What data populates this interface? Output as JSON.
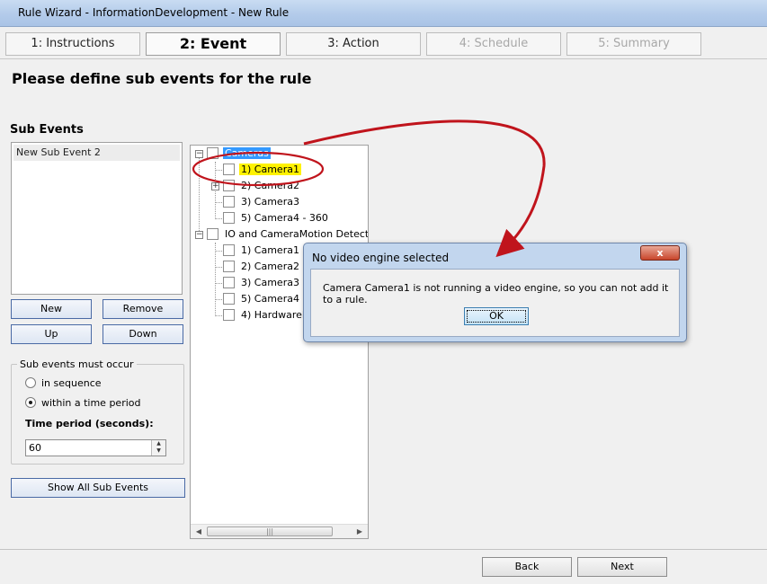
{
  "window": {
    "title": "Rule Wizard - InformationDevelopment - New Rule"
  },
  "tabs": [
    {
      "label": "1: Instructions",
      "state": "normal"
    },
    {
      "label": "2: Event",
      "state": "active"
    },
    {
      "label": "3: Action",
      "state": "normal"
    },
    {
      "label": "4: Schedule",
      "state": "disabled"
    },
    {
      "label": "5: Summary",
      "state": "disabled"
    }
  ],
  "heading": "Please define sub events for the rule",
  "sub_events": {
    "label": "Sub Events",
    "items": [
      "New Sub Event 2"
    ],
    "buttons": {
      "new": "New",
      "remove": "Remove",
      "up": "Up",
      "down": "Down"
    },
    "occur_group": {
      "title": "Sub events must occur",
      "options": [
        "in sequence",
        "within a time period"
      ],
      "selected": "within a time period"
    },
    "time_period": {
      "label": "Time period (seconds):",
      "value": "60"
    },
    "show_all": "Show All Sub Events"
  },
  "tree": {
    "groups": [
      {
        "label": "Cameras",
        "selected": true,
        "children": [
          {
            "label": "1) Camera1",
            "highlighted": true
          },
          {
            "label": "2) Camera2",
            "expandable": true
          },
          {
            "label": "3) Camera3"
          },
          {
            "label": "5) Camera4 - 360"
          }
        ]
      },
      {
        "label": "IO and CameraMotion Detection",
        "children": [
          {
            "label": "1) Camera1"
          },
          {
            "label": "2) Camera2"
          },
          {
            "label": "3) Camera3"
          },
          {
            "label": "5) Camera4 - 360"
          },
          {
            "label": "4) HardwareD"
          }
        ]
      }
    ]
  },
  "dialog": {
    "title": "No video engine selected",
    "close": "x",
    "message": "Camera Camera1 is not running a video engine, so you can not add it to a rule.",
    "ok": "OK"
  },
  "footer": {
    "back": "Back",
    "next": "Next"
  },
  "colors": {
    "selection": "#3399ff",
    "highlight": "#fff200",
    "annotation": "#c0141c"
  }
}
